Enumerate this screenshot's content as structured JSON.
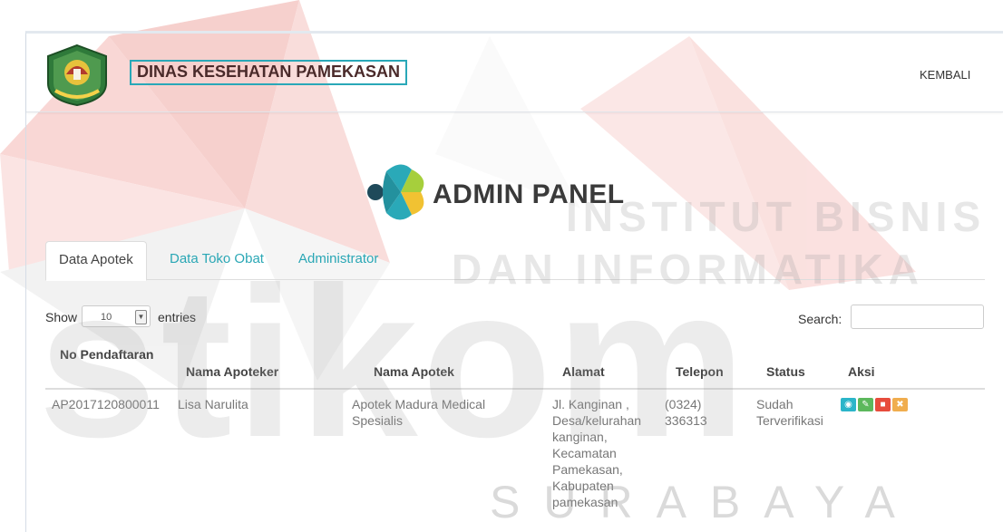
{
  "header": {
    "site_title": "DINAS KESEHATAN PAMEKASAN",
    "back_label": "KEMBALI"
  },
  "brand": {
    "panel_title": "ADMIN PANEL"
  },
  "tabs": [
    {
      "label": "Data Apotek",
      "active": true
    },
    {
      "label": "Data Toko Obat",
      "active": false
    },
    {
      "label": "Administrator",
      "active": false
    }
  ],
  "table_controls": {
    "show_label": "Show",
    "entries_value": "10",
    "entries_label": "entries",
    "search_label": "Search:",
    "search_value": ""
  },
  "table": {
    "columns": [
      "No Pendaftaran",
      "Nama Apoteker",
      "Nama Apotek",
      "Alamat",
      "Telepon",
      "Status",
      "Aksi"
    ],
    "rows": [
      {
        "no_pendaftaran": "AP2017120800011",
        "nama_apoteker": "Lisa Narulita",
        "nama_apotek": "Apotek Madura Medical Spesialis",
        "alamat": "Jl. Kanginan , Desa/kelurahan kanginan, Kecamatan Pamekasan, Kabupaten pamekasan",
        "telepon": "(0324) 336313",
        "status": "Sudah Terverifikasi",
        "actions": [
          "eye-icon",
          "pencil-icon",
          "trash-icon",
          "close-icon"
        ]
      }
    ]
  },
  "watermark": {
    "line1": "INSTITUT BISNIS",
    "line2": "DAN INFORMATIKA",
    "logo_text": "stikom",
    "city": "SURABAYA"
  },
  "colors": {
    "accent": "#29a8b8",
    "title_text": "#4a2a2a",
    "btn_view": "#2bb5c9",
    "btn_edit": "#5cb85c",
    "btn_delete": "#e74c3c",
    "btn_close": "#f0ad4e"
  }
}
